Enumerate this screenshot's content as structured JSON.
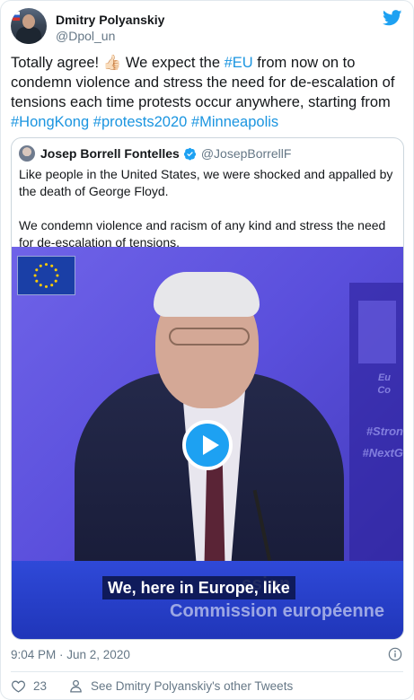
{
  "tweet": {
    "author_name": "Dmitry Polyanskiy",
    "author_handle": "@Dpol_un",
    "text_parts": {
      "p1": "Totally agree! 👍🏻 We expect the ",
      "tag_eu": "#EU",
      "p2": " from now on to condemn violence and stress the need for de-escalation of tensions each time protests occur anywhere, starting from ",
      "tag_hk": "#HongKong",
      "tag_protests": "#protests2020",
      "tag_minneapolis": "#Minneapolis"
    },
    "timestamp": "9:04 PM · Jun 2, 2020",
    "like_count": "23",
    "see_more_label": "See Dmitry Polyanskiy's other Tweets"
  },
  "quoted": {
    "author_name": "Josep Borrell Fontelles",
    "author_handle": "@JosepBorrellF",
    "paragraph1": "Like people in the United States, we were shocked and appalled by the death of George Floyd.",
    "paragraph2": "We condemn violence and racism of any kind and stress the need for de-escalation of tensions.",
    "video": {
      "caption": "We, here in Europe, like",
      "podium_line1": "ssion",
      "podium_line2": "Commission européenne",
      "bg_words": [
        "Eu",
        "Co",
        "#Stron",
        "#NextG"
      ]
    }
  },
  "colors": {
    "accent": "#1da1f2",
    "hashtag": "#1b95e0",
    "secondary_text": "#657786"
  },
  "icons": [
    "twitter-logo-icon",
    "verified-badge-icon",
    "eu-flag-icon",
    "play-icon",
    "info-icon",
    "heart-icon",
    "person-icon"
  ]
}
